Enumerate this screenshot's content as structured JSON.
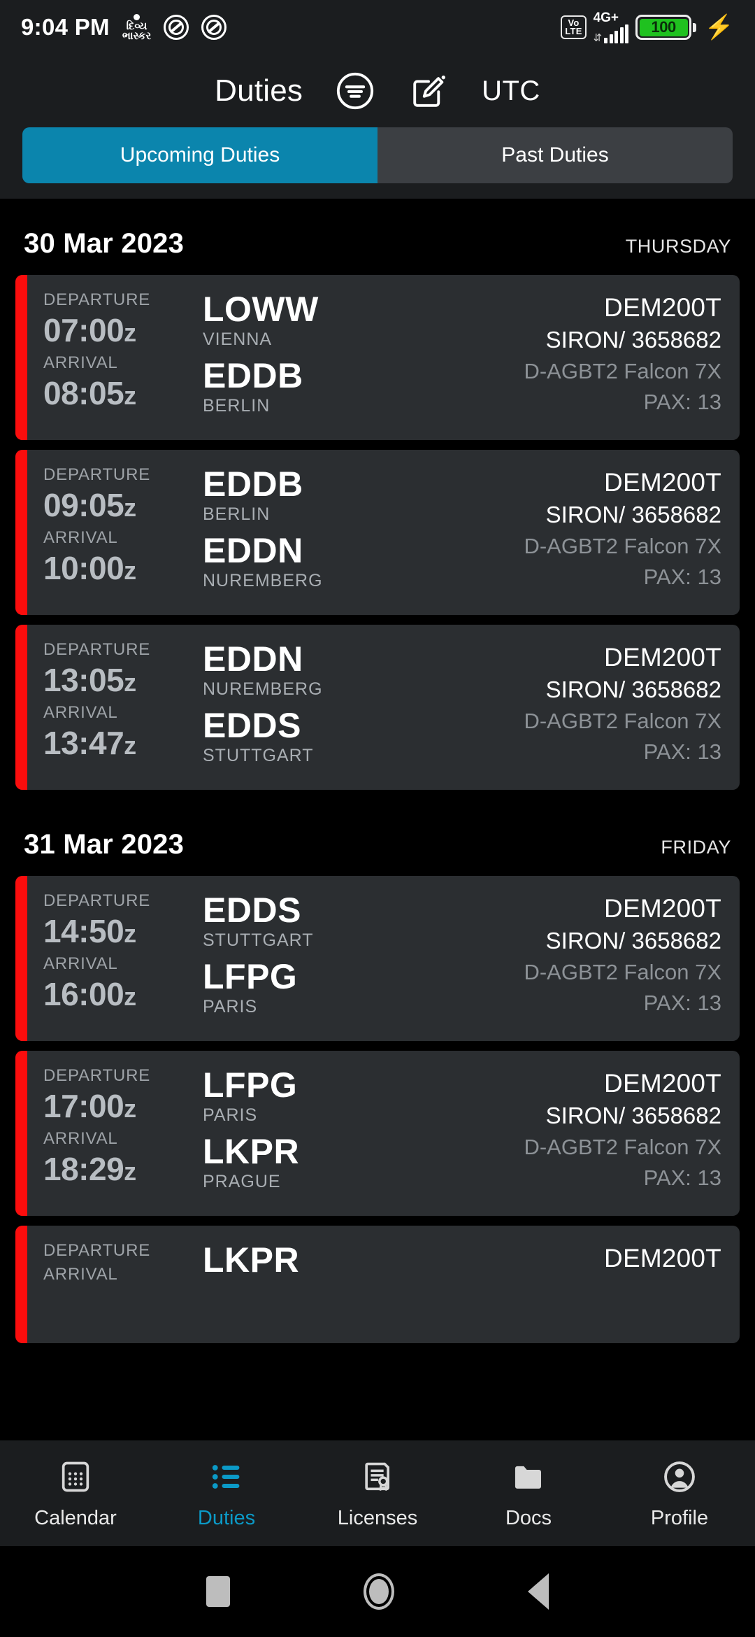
{
  "status_bar": {
    "clock": "9:04 PM",
    "gujarati_badge": "દિવ્ય ભાસ્કર",
    "network_label": "4G+",
    "volte_top": "Vo",
    "volte_bottom": "LTE",
    "battery_percent": "100",
    "icons": [
      "app-badge-icon",
      "no-sound-icon",
      "no-sound-icon",
      "volte-icon",
      "signal-bars-icon",
      "battery-icon",
      "charging-bolt-icon"
    ]
  },
  "header": {
    "title": "Duties",
    "filter_icon": "filter-circle-icon",
    "edit_icon": "edit-compose-icon",
    "timezone": "UTC"
  },
  "tabs": [
    {
      "label": "Upcoming Duties",
      "active": true
    },
    {
      "label": "Past Duties",
      "active": false
    }
  ],
  "colors": {
    "accent": "#0b85ad",
    "accent_nav": "#0b9ac7",
    "card_bar": "#fb0d0d",
    "card_bg": "#2b2e31",
    "battery_green": "#1fc11f"
  },
  "labels": {
    "departure": "DEPARTURE",
    "arrival": "ARRIVAL"
  },
  "groups": [
    {
      "date": "30 Mar 2023",
      "weekday": "THURSDAY",
      "flights": [
        {
          "departure_time": "07:00",
          "departure_suffix": "z",
          "arrival_time": "08:05",
          "arrival_suffix": "z",
          "origin_code": "LOWW",
          "origin_city": "VIENNA",
          "dest_code": "EDDB",
          "dest_city": "BERLIN",
          "flight_no": "DEM200T",
          "operator": "SIRON/ 3658682",
          "aircraft": "D-AGBT2 Falcon 7X",
          "pax": "PAX: 13"
        },
        {
          "departure_time": "09:05",
          "departure_suffix": "z",
          "arrival_time": "10:00",
          "arrival_suffix": "z",
          "origin_code": "EDDB",
          "origin_city": "BERLIN",
          "dest_code": "EDDN",
          "dest_city": "NUREMBERG",
          "flight_no": "DEM200T",
          "operator": "SIRON/ 3658682",
          "aircraft": "D-AGBT2 Falcon 7X",
          "pax": "PAX: 13"
        },
        {
          "departure_time": "13:05",
          "departure_suffix": "z",
          "arrival_time": "13:47",
          "arrival_suffix": "z",
          "origin_code": "EDDN",
          "origin_city": "NUREMBERG",
          "dest_code": "EDDS",
          "dest_city": "STUTTGART",
          "flight_no": "DEM200T",
          "operator": "SIRON/ 3658682",
          "aircraft": "D-AGBT2 Falcon 7X",
          "pax": "PAX: 13"
        }
      ]
    },
    {
      "date": "31 Mar 2023",
      "weekday": "FRIDAY",
      "flights": [
        {
          "departure_time": "14:50",
          "departure_suffix": "z",
          "arrival_time": "16:00",
          "arrival_suffix": "z",
          "origin_code": "EDDS",
          "origin_city": "STUTTGART",
          "dest_code": "LFPG",
          "dest_city": "PARIS",
          "flight_no": "DEM200T",
          "operator": "SIRON/ 3658682",
          "aircraft": "D-AGBT2 Falcon 7X",
          "pax": "PAX: 13"
        },
        {
          "departure_time": "17:00",
          "departure_suffix": "z",
          "arrival_time": "18:29",
          "arrival_suffix": "z",
          "origin_code": "LFPG",
          "origin_city": "PARIS",
          "dest_code": "LKPR",
          "dest_city": "PRAGUE",
          "flight_no": "DEM200T",
          "operator": "SIRON/ 3658682",
          "aircraft": "D-AGBT2 Falcon 7X",
          "pax": "PAX: 13"
        },
        {
          "departure_time": "",
          "departure_suffix": "",
          "arrival_time": "",
          "arrival_suffix": "",
          "origin_code": "LKPR",
          "origin_city": "",
          "dest_code": "",
          "dest_city": "",
          "flight_no": "DEM200T",
          "operator": "",
          "aircraft": "",
          "pax": "",
          "partial": true
        }
      ]
    }
  ],
  "bottom_nav": [
    {
      "label": "Calendar",
      "icon": "calendar-icon",
      "active": false
    },
    {
      "label": "Duties",
      "icon": "list-bullet-icon",
      "active": true
    },
    {
      "label": "Licenses",
      "icon": "certificate-icon",
      "active": false
    },
    {
      "label": "Docs",
      "icon": "folder-icon",
      "active": false
    },
    {
      "label": "Profile",
      "icon": "person-circle-icon",
      "active": false
    }
  ],
  "system_nav": [
    {
      "icon": "recents-square-icon"
    },
    {
      "icon": "home-circle-icon"
    },
    {
      "icon": "back-triangle-icon"
    }
  ]
}
